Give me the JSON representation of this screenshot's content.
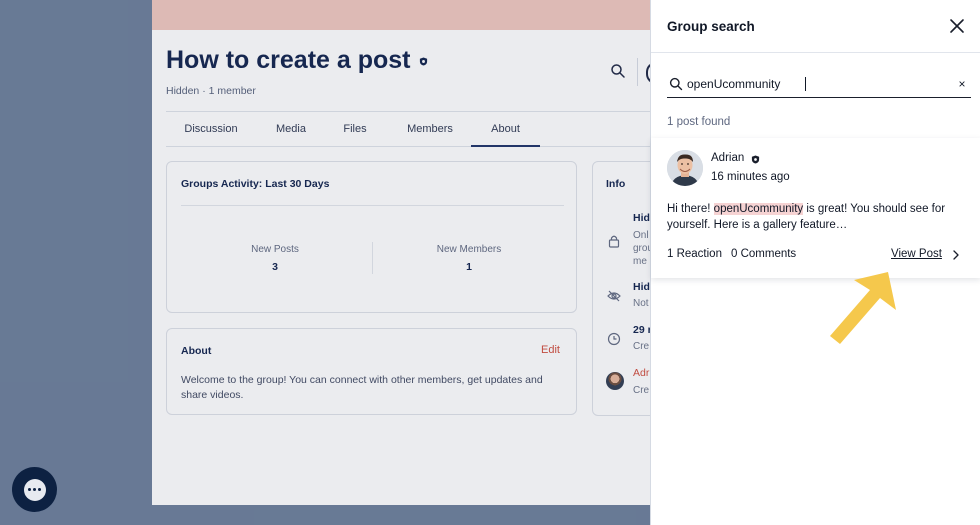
{
  "group": {
    "title": "How to create a post",
    "subtitle": "Hidden · 1 member"
  },
  "tabs": [
    {
      "label": "Discussion"
    },
    {
      "label": "Media"
    },
    {
      "label": "Files"
    },
    {
      "label": "Members"
    },
    {
      "label": "About",
      "active": true
    }
  ],
  "activity": {
    "title": "Groups Activity: Last 30 Days",
    "new_posts_label": "New Posts",
    "new_posts_value": "3",
    "new_members_label": "New Members",
    "new_members_value": "1"
  },
  "about": {
    "title": "About",
    "edit_label": "Edit",
    "text": "Welcome to the group! You can connect with other members, get updates and share videos."
  },
  "info": {
    "title": "Info",
    "rows": [
      {
        "icon": "lock-icon",
        "title": "Hid",
        "lines": [
          "Onl",
          "grou",
          "me"
        ]
      },
      {
        "icon": "eye-off-icon",
        "title": "Hid",
        "lines": [
          "Not"
        ]
      },
      {
        "icon": "clock-icon",
        "title": "29 r",
        "lines": [
          "Cre"
        ]
      },
      {
        "icon": "avatar",
        "title": "Adr",
        "lines": [
          "Cre"
        ]
      }
    ]
  },
  "panel": {
    "title": "Group search",
    "search_value": "openUcommunity",
    "result_count": "1 post found",
    "result": {
      "author": "Adrian",
      "time": "16 minutes ago",
      "text_before": "Hi there! ",
      "text_highlight": "openUcommunity",
      "text_after": " is great! You should see for yourself. Here is a gallery feature…",
      "reactions": "1 Reaction",
      "comments": "0 Comments",
      "view_post": "View Post"
    }
  },
  "colors": {
    "accent_navy": "#0d1f4a",
    "edit_red": "#d04a3a",
    "highlight": "#f6d3d3",
    "arrow_yellow": "#f5c84c"
  }
}
